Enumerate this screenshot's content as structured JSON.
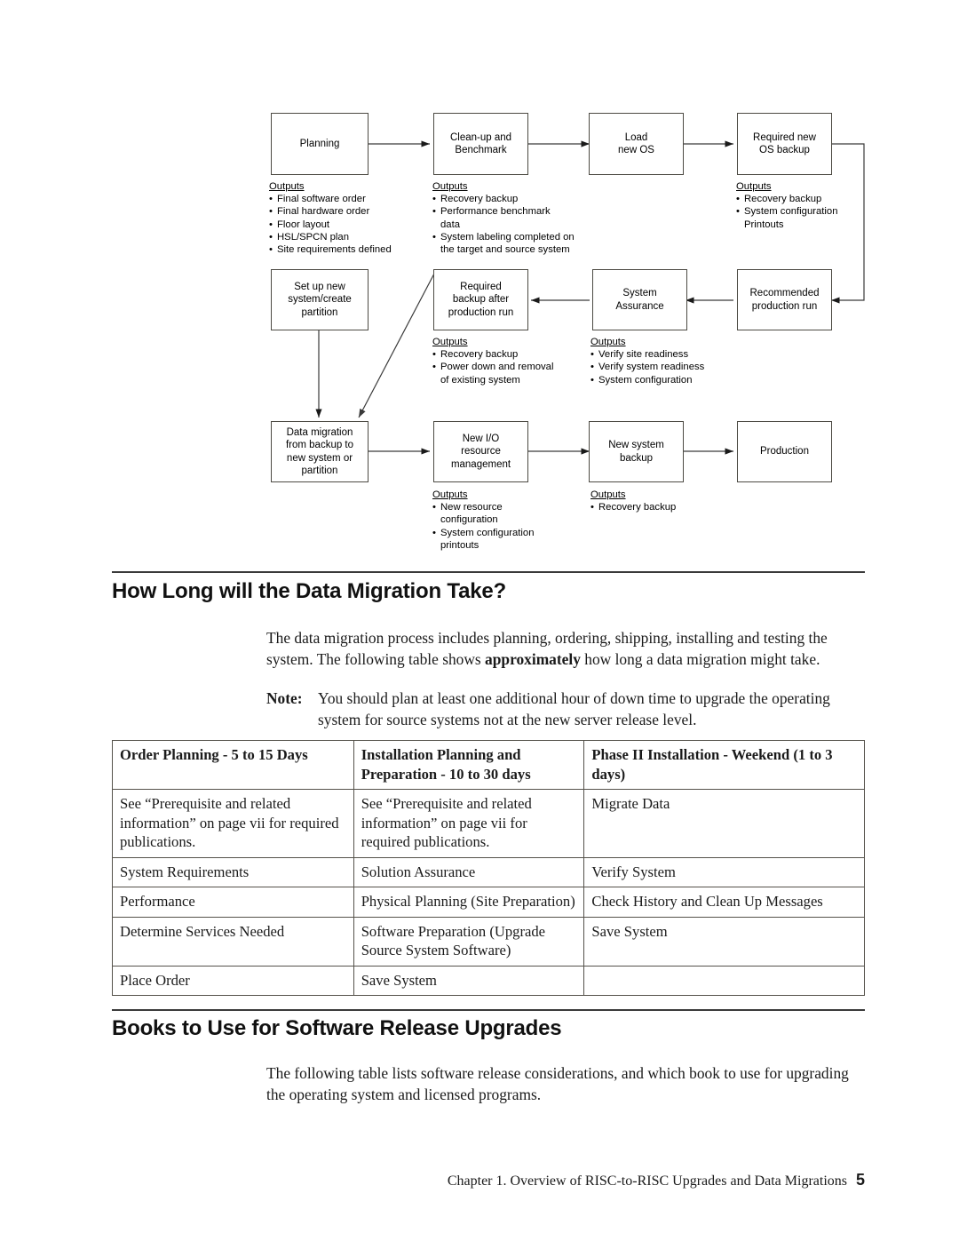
{
  "diagram": {
    "nodes": [
      {
        "id": "planning",
        "label": "Planning"
      },
      {
        "id": "cleanup",
        "label": "Clean-up and\nBenchmark"
      },
      {
        "id": "load-os",
        "label": "Load\nnew OS"
      },
      {
        "id": "required-os-backup",
        "label": "Required new\nOS backup"
      },
      {
        "id": "setup-new-system",
        "label": "Set up new\nsystem/create\npartition"
      },
      {
        "id": "required-backup",
        "label": "Required\nbackup after\nproduction run"
      },
      {
        "id": "system-assurance",
        "label": "System\nAssurance"
      },
      {
        "id": "recommended-run",
        "label": "Recommended\nproduction run"
      },
      {
        "id": "data-migration",
        "label": "Data migration\nfrom backup to\nnew system or\npartition"
      },
      {
        "id": "new-io",
        "label": "New I/O\nresource\nmanagement"
      },
      {
        "id": "new-system-backup",
        "label": "New system\nbackup"
      },
      {
        "id": "production",
        "label": "Production"
      }
    ],
    "outputs_title": "Outputs",
    "outputs": {
      "planning": [
        "Final software order",
        "Final hardware order",
        "Floor layout",
        "HSL/SPCN plan",
        "Site requirements defined"
      ],
      "cleanup": [
        "Recovery backup",
        "Performance benchmark\ndata",
        "System labeling completed on\nthe target and source system"
      ],
      "required_os_backup": [
        "Recovery backup",
        "System configuration\nPrintouts"
      ],
      "required_backup": [
        "Recovery backup",
        "Power down and removal\nof existing system"
      ],
      "system_assurance": [
        "Verify site readiness",
        "Verify system readiness",
        "System configuration"
      ],
      "new_io": [
        "New resource\nconfiguration",
        "System configuration\nprintouts"
      ],
      "new_system_backup": [
        "Recovery backup"
      ]
    }
  },
  "section1": {
    "heading": "How Long will the Data Migration Take?",
    "paragraph_part1": "The data migration process includes planning, ordering, shipping, installing and testing the system. The following table shows ",
    "paragraph_bold": "approximately",
    "paragraph_part2": " how long a data migration might take.",
    "note_label": "Note:",
    "note_text": "You should plan at least one additional hour of down time to upgrade the operating system for source systems not at the new server release level."
  },
  "table": {
    "headers": [
      "Order Planning - 5 to 15 Days",
      "Installation Planning and Preparation - 10 to 30 days",
      "Phase II Installation - Weekend (1 to 3 days)"
    ],
    "rows": [
      [
        "See “Prerequisite and related information” on page vii for required publications.",
        "See “Prerequisite and related information” on page vii for required publications.",
        "Migrate Data"
      ],
      [
        "System Requirements",
        "Solution Assurance",
        "Verify System"
      ],
      [
        "Performance",
        "Physical Planning (Site Preparation)",
        "Check History and Clean Up Messages"
      ],
      [
        "Determine Services Needed",
        "Software Preparation (Upgrade Source System Software)",
        "Save System"
      ],
      [
        "Place Order",
        "Save System",
        ""
      ]
    ]
  },
  "section2": {
    "heading": "Books to Use for Software Release Upgrades",
    "paragraph": "The following table lists software release considerations, and which book to use for upgrading the operating system and licensed programs."
  },
  "footer": {
    "text": "Chapter 1. Overview of RISC-to-RISC Upgrades and Data Migrations",
    "page": "5"
  }
}
